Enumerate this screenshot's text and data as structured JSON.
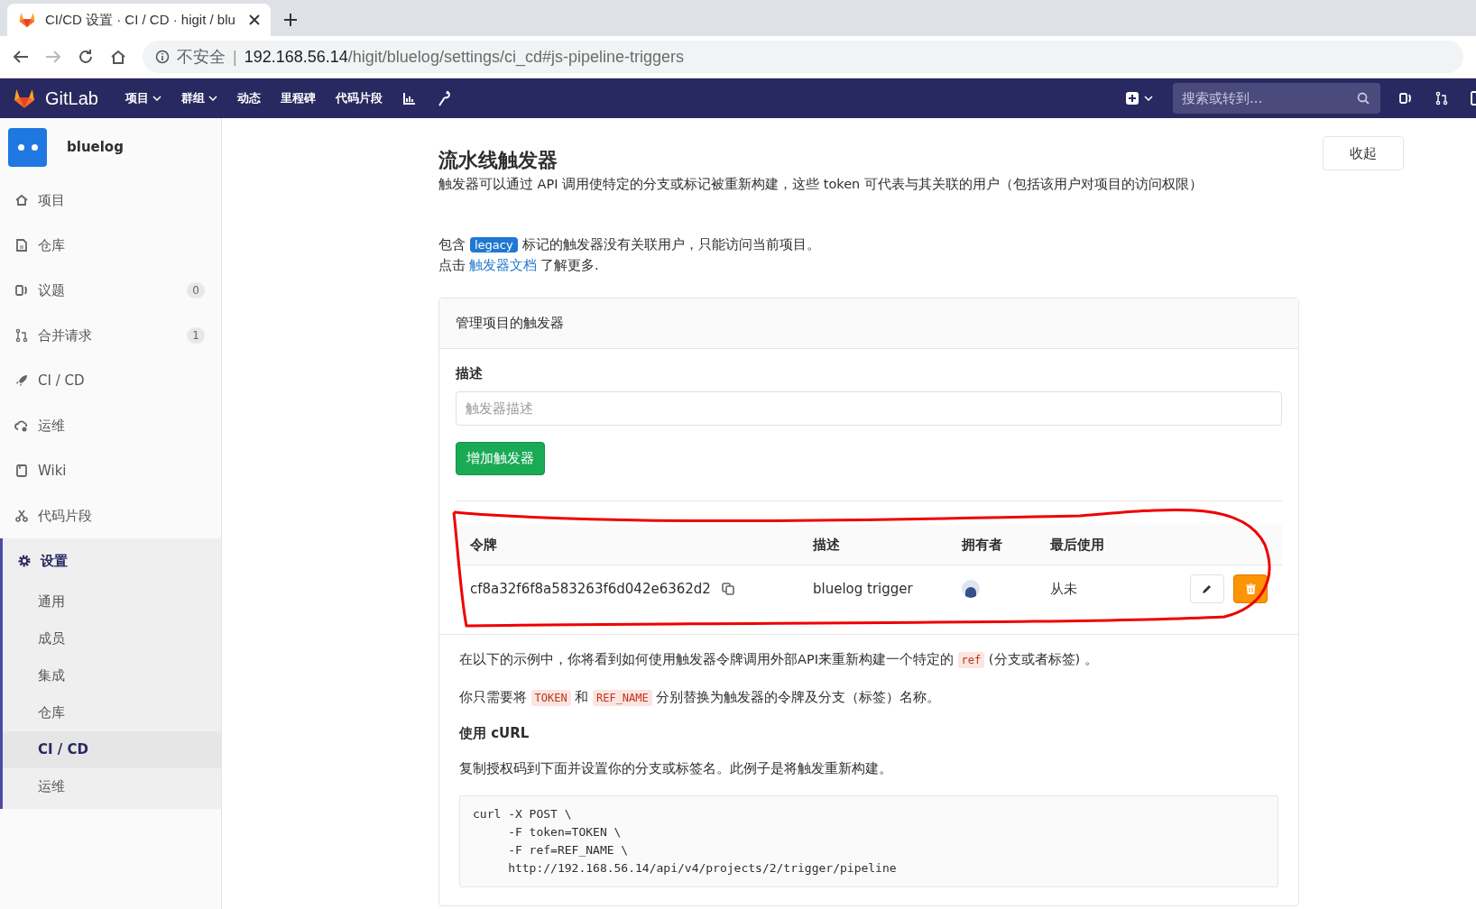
{
  "browser": {
    "tab_title": "CI/CD 设置 · CI / CD · higit / blu",
    "url_insecure": "不安全",
    "url_separator": "|",
    "url_host": "192.168.56.14",
    "url_path": "/higit/bluelog/settings/ci_cd#js-pipeline-triggers"
  },
  "navbar": {
    "brand": "GitLab",
    "items": [
      {
        "label": "项目",
        "dropdown": true
      },
      {
        "label": "群组",
        "dropdown": true
      },
      {
        "label": "动态",
        "dropdown": false
      },
      {
        "label": "里程碑",
        "dropdown": false
      },
      {
        "label": "代码片段",
        "dropdown": false
      }
    ],
    "search": {
      "placeholder": "搜索或转到..."
    }
  },
  "sidebar": {
    "project": "bluelog",
    "items": [
      {
        "label": "项目",
        "selected": false
      },
      {
        "label": "仓库",
        "selected": false
      },
      {
        "label": "议题",
        "count": "0",
        "selected": false
      },
      {
        "label": "合并请求",
        "count": "1",
        "selected": false
      },
      {
        "label": "CI / CD",
        "selected": false
      },
      {
        "label": "运维",
        "selected": false
      },
      {
        "label": "Wiki",
        "selected": false
      },
      {
        "label": "代码片段",
        "selected": false
      },
      {
        "label": "设置",
        "selected": true,
        "children": [
          {
            "label": "通用",
            "selected": false
          },
          {
            "label": "成员",
            "selected": false
          },
          {
            "label": "集成",
            "selected": false
          },
          {
            "label": "仓库",
            "selected": false
          },
          {
            "label": "CI / CD",
            "selected": true
          },
          {
            "label": "运维",
            "selected": false
          }
        ]
      }
    ]
  },
  "section": {
    "title": "流水线触发器",
    "collapse_button": "收起",
    "description": "触发器可以通过 API 调用使特定的分支或标记被重新构建，这些 token 可代表与其关联的用户（包括该用户对项目的访问权限）",
    "legacy_note": {
      "before": "包含",
      "badge": "legacy",
      "after": "标记的触发器没有关联用户，只能访问当前项目。"
    },
    "docs_note": {
      "before": "点击",
      "link": "触发器文档",
      "after": "了解更多."
    }
  },
  "card": {
    "header": "管理项目的触发器",
    "form": {
      "label": "描述",
      "placeholder": "触发器描述",
      "submit": "增加触发器"
    },
    "table": {
      "columns": [
        "令牌",
        "描述",
        "拥有者",
        "最后使用"
      ],
      "rows": [
        {
          "token": "cf8a32f6f8a583263f6d042e6362d2",
          "description": "bluelog trigger",
          "last_used": "从未"
        }
      ]
    },
    "examples": [
      {
        "kind": "text",
        "segments": [
          {
            "kind": "text",
            "text": "在以下的示例中，你将看到如何使用触发器令牌调用外部API来重新构建一个特定的 "
          },
          {
            "kind": "code",
            "text": "ref"
          },
          {
            "kind": "text",
            "text": " (分支或者标签) 。"
          }
        ]
      },
      {
        "kind": "text",
        "segments": [
          {
            "kind": "text",
            "text": "你只需要将 "
          },
          {
            "kind": "code",
            "text": "TOKEN"
          },
          {
            "kind": "text",
            "text": " 和 "
          },
          {
            "kind": "code",
            "text": "REF_NAME"
          },
          {
            "kind": "text",
            "text": " 分别替换为触发器的令牌及分支（标签）名称。"
          }
        ]
      },
      {
        "kind": "heading",
        "text": "使用 cURL"
      },
      {
        "kind": "text",
        "segments": [
          {
            "kind": "text",
            "text": "复制授权码到下面并设置你的分支或标签名。此例子是将触发重新构建。"
          }
        ]
      },
      {
        "kind": "code",
        "lines": [
          "curl -X POST \\",
          "     -F token=TOKEN \\",
          "     -F ref=REF_NAME \\",
          "     http://192.168.56.14/api/v4/projects/2/trigger/pipeline"
        ]
      }
    ]
  }
}
